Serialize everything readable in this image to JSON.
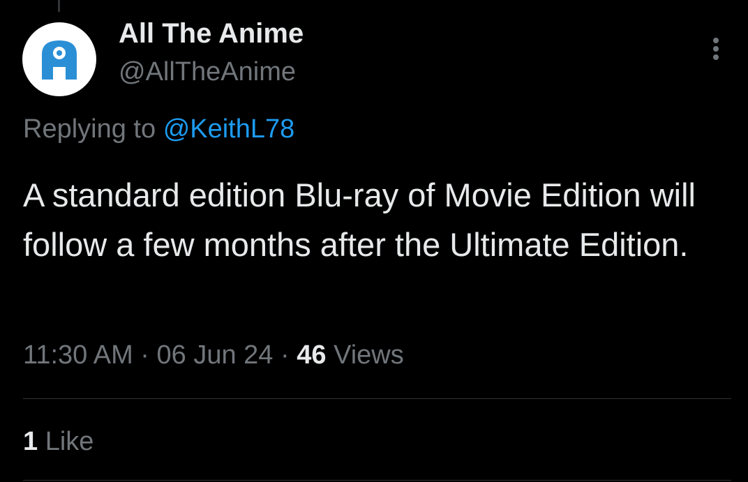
{
  "author": {
    "display_name": "All The Anime",
    "handle": "@AllTheAnime",
    "avatar_icon": "all-the-anime-logo",
    "avatar_color": "#2b8fd6"
  },
  "reply": {
    "prefix": "Replying to",
    "mention": "@KeithL78"
  },
  "tweet": {
    "text": "A standard edition Blu-ray of Movie Edition will follow a few months after the Ultimate Edition."
  },
  "meta": {
    "time": "11:30 AM",
    "separator": "·",
    "date": "06 Jun 24",
    "views_count": "46",
    "views_label": "Views"
  },
  "engagement": {
    "likes_count": "1",
    "likes_label": "Like"
  },
  "icons": {
    "more": "more-vertical-icon"
  },
  "colors": {
    "background": "#000000",
    "primary_text": "#e7e9ea",
    "secondary_text": "#71767b",
    "accent": "#1d9bf0",
    "divider": "#2f3336"
  }
}
